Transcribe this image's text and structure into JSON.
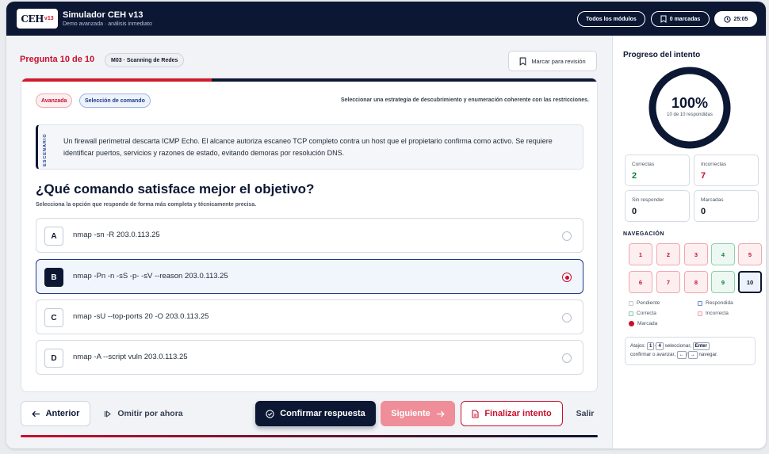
{
  "header": {
    "logo_text": "CEH",
    "logo_version": "v13",
    "title": "Simulador CEH v13",
    "subtitle": "Demo avanzada · análisis inmediato",
    "modules_button": "Todos los módulos",
    "marked_button": "0 marcadas",
    "timer": "25:05"
  },
  "question_header": {
    "number": "Pregunta 10 de 10",
    "module": "M03 · Scanning de Redes",
    "mark_button": "Marcar para revisión"
  },
  "card": {
    "badge_level": "Avanzada",
    "badge_type": "Selección de comando",
    "strategy": "Seleccionar una estrategia de descubrimiento y enumeración coherente con las restricciones.",
    "scenario_label": "ESCENARIO",
    "scenario": "Un firewall perimetral descarta ICMP Echo. El alcance autoriza escaneo TCP completo contra un host que el propietario confirma como activo. Se requiere identificar puertos, servicios y razones de estado, evitando demoras por resolución DNS.",
    "question": "¿Qué comando satisface mejor el objetivo?",
    "instruction": "Selecciona la opción que responde de forma más completa y técnicamente precisa.",
    "options": [
      {
        "key": "A",
        "text": "nmap -sn -R 203.0.113.25",
        "selected": false
      },
      {
        "key": "B",
        "text": "nmap -Pn -n -sS -p- -sV --reason 203.0.113.25",
        "selected": true
      },
      {
        "key": "C",
        "text": "nmap -sU --top-ports 20 -O 203.0.113.25",
        "selected": false
      },
      {
        "key": "D",
        "text": "nmap -A --script vuln 203.0.113.25",
        "selected": false
      }
    ]
  },
  "footer": {
    "prev": "Anterior",
    "skip": "Omitir por ahora",
    "confirm": "Confirmar respuesta",
    "next": "Siguiente",
    "finish": "Finalizar intento",
    "exit": "Salir"
  },
  "sidebar": {
    "title": "Progreso del intento",
    "progress_fraction": 1.0,
    "progress_pct": "100%",
    "progress_sub": "10 de 10 respondidas",
    "stats": {
      "correct_label": "Correctas",
      "correct": "2",
      "incorrect_label": "Incorrectas",
      "incorrect": "7",
      "unanswered_label": "Sin responder",
      "unanswered": "0",
      "marked_label": "Marcadas",
      "marked": "0"
    },
    "nav_title": "NAVEGACIÓN",
    "nav": [
      {
        "n": "1",
        "state": "incorrect"
      },
      {
        "n": "2",
        "state": "incorrect"
      },
      {
        "n": "3",
        "state": "incorrect"
      },
      {
        "n": "4",
        "state": "correct"
      },
      {
        "n": "5",
        "state": "incorrect"
      },
      {
        "n": "6",
        "state": "incorrect"
      },
      {
        "n": "7",
        "state": "incorrect"
      },
      {
        "n": "8",
        "state": "incorrect"
      },
      {
        "n": "9",
        "state": "correct"
      },
      {
        "n": "10",
        "state": "current"
      }
    ],
    "legend": {
      "pending": "Pendiente",
      "answered": "Respondida",
      "correct": "Correcta",
      "incorrect": "Incorrecta",
      "marked": "Marcada"
    },
    "shortcuts": {
      "prefix": "Atajos:",
      "key1": "1",
      "dash": "-",
      "key4": "4",
      "select": "seleccionar,",
      "enter": "Enter",
      "confirm": "confirmar o avanzar,",
      "left": "←",
      "slash": "/",
      "right": "→",
      "navigate": "navegar."
    }
  },
  "colors": {
    "navy": "#0b1733",
    "red": "#c8102e",
    "green": "#15803d"
  }
}
